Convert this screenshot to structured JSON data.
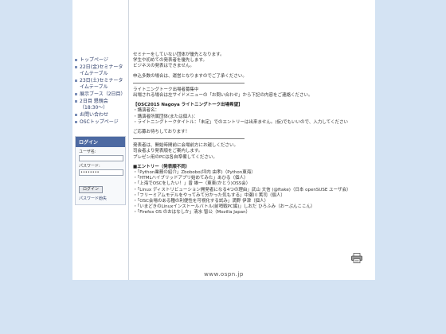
{
  "sidebar": {
    "menu": [
      "トップページ",
      "22日(金)セミナータイムテーブル",
      "23日(土)セミナータイムテーブル",
      "展示ブース（2日目）",
      "2日目 懇親会（18:30〜）",
      "お問い合わせ",
      "OSCトップページ"
    ],
    "login": {
      "title": "ログイン",
      "user_label": "ユーザ名:",
      "password_label": "パスワード:",
      "password_value": "••••••••",
      "login_button": "ログイン",
      "forgot_link": "パスワード紛失"
    }
  },
  "content": {
    "intro": [
      "セミナーをしていない団体が優先となります。",
      "学生や初めての発表者を優先します。",
      "ビジネスの発表はできません。"
    ],
    "lottery": "申込多数の場合は、運営となりますのでご了承ください。",
    "recruit": [
      "ライトニングトーク出場者募集中",
      "出場される場合は左サイドメニューの「お問い合わせ」から下記の内容をご連絡ください。"
    ],
    "form_title": "【OSC2015 Nagoya ライトニングトーク出場希望】",
    "form_fields": [
      "・講演者名：",
      "・講演者所属団体(または個人)：",
      "・ライトニングトークタイトル：「未定」でのエントリーは出来ません。(仮)でもいいので、入力してください"
    ],
    "waiting": "ご応募お待ちしております！",
    "notes": [
      "発表者は、開始時間前に会場前方にお越しください。",
      "司会者より発表順をご案内します。",
      "プレゼン用のPCは各自準備してください。"
    ],
    "entry_title": "■エントリー（発表順不同）",
    "entries": [
      "・「Python業務の紹介」Zbobobo(坪内 由孝)（Python東海）",
      "・「HTMLハイブリッドアプリ始めてみた」あひる（個人）",
      "・「上海でOSCをしたい！」曾 雄一（東東(かとう)OSS会）",
      "・「Linux ディストリビューション開発者になる4つの理由」武山 文信 (@ftake)（日本 openSUSE ユーザ会）",
      "・「フリーミアムモデルをやってみて分かった気もする」中瀬川 篤司（個人）",
      "・「OSC会場のある種の利便性を可視化する試み」満野 伊津（個人）",
      "・「いまどきのLinuxインストールバトル(前哨戦PC編)」しおだ ひろふみ（おーぷんここん）",
      "・「Firefox OS のおはなしか」清水 智公（Mozilla Japan）"
    ]
  },
  "footer": {
    "domain": "www.ospn.jp"
  },
  "icons": {
    "print": "printer-icon"
  },
  "colors": {
    "background": "#d4e3f3",
    "login_header": "#4d6aa2",
    "link": "#2a3a66"
  }
}
